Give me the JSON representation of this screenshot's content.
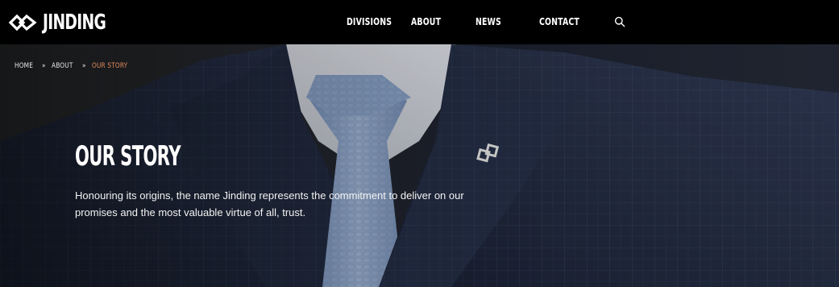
{
  "brand": {
    "logo_icon": "jinding-logo-icon",
    "name": "JINDING"
  },
  "nav": {
    "items": [
      {
        "label": "DIVISIONS"
      },
      {
        "label": "ABOUT"
      },
      {
        "label": "NEWS"
      },
      {
        "label": "CONTACT"
      }
    ],
    "search_icon": "search-icon"
  },
  "breadcrumb": {
    "items": [
      {
        "label": "HOME"
      },
      {
        "label": "ABOUT"
      },
      {
        "label": "OUR STORY"
      }
    ],
    "separator": "»"
  },
  "hero": {
    "title": "OUR STORY",
    "description": "Honouring its origins, the name Jinding represents the commitment to deliver on our promises and the most valuable virtue of all, trust.",
    "background": "navy-pinstripe-suit-with-light-blue-tie-and-lapel-pin"
  },
  "colors": {
    "header_bg": "#000000",
    "breadcrumb_current": "#e28a5c",
    "text": "#ffffff"
  }
}
